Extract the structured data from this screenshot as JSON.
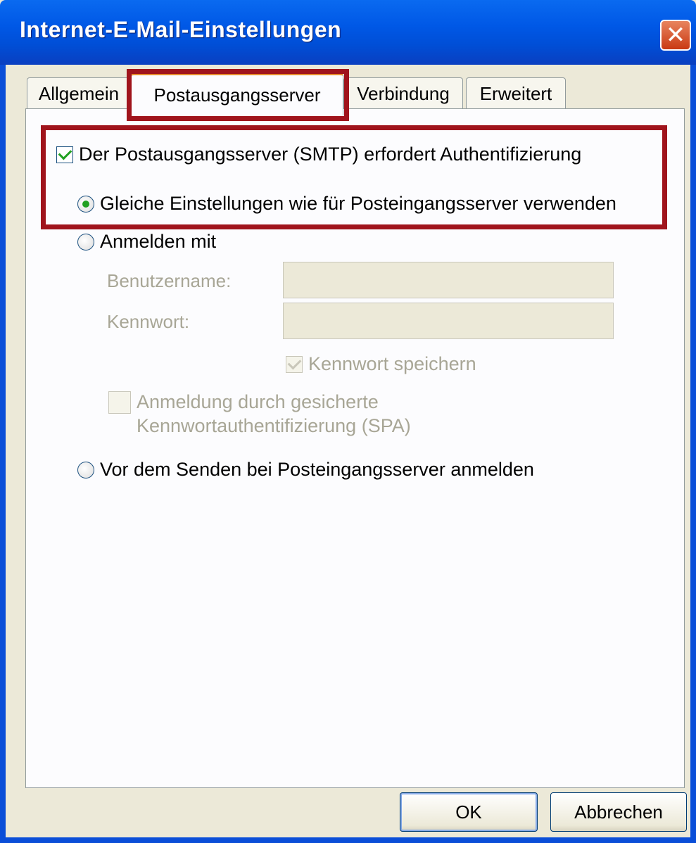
{
  "window": {
    "title": "Internet-E-Mail-Einstellungen",
    "close_glyph": "✕"
  },
  "tabs": [
    {
      "label": "Allgemein",
      "active": false
    },
    {
      "label": "Postausgangsserver",
      "active": true
    },
    {
      "label": "Verbindung",
      "active": false
    },
    {
      "label": "Erweitert",
      "active": false
    }
  ],
  "options": {
    "smtp_auth_label": "Der Postausgangsserver (SMTP) erfordert Authentifizierung",
    "smtp_auth_checked": true,
    "same_settings_label": "Gleiche Einstellungen wie für Posteingangsserver verwenden",
    "same_settings_selected": true,
    "login_with_label": "Anmelden mit",
    "username_label": "Benutzername:",
    "username_value": "",
    "password_label": "Kennwort:",
    "password_value": "",
    "save_password_label": "Kennwort speichern",
    "save_password_checked": true,
    "spa_label_line1": "Anmeldung durch gesicherte",
    "spa_label_line2": "Kennwortauthentifizierung (SPA)",
    "spa_checked": false,
    "login_before_send_label": "Vor dem Senden bei Posteingangsserver anmelden"
  },
  "buttons": {
    "ok": "OK",
    "cancel": "Abbrechen"
  },
  "colors": {
    "titlebar": "#0058e6",
    "highlight": "#a0141c",
    "check": "#21a121"
  }
}
